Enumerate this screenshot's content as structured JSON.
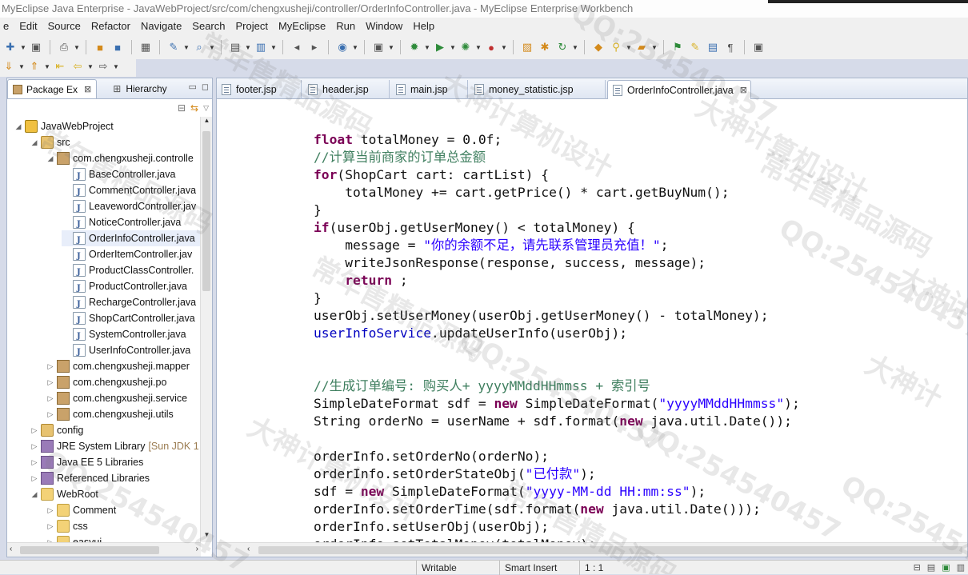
{
  "window": {
    "title": "MyEclipse Java Enterprise - JavaWebProject/src/com/chengxusheji/controller/OrderInfoController.java - MyEclipse Enterprise Workbench"
  },
  "menu": [
    {
      "label": "File",
      "mnemonic": "F",
      "rest": "ile"
    },
    {
      "label": "Edit",
      "mnemonic": "E",
      "rest": "dit"
    },
    {
      "label": "Source",
      "mnemonic": "S",
      "rest": "ource"
    },
    {
      "label": "Refactor",
      "mnemonic": "T",
      "rest": "Refactor"
    },
    {
      "label": "Navigate",
      "mnemonic": "N",
      "rest": "avigate"
    },
    {
      "label": "Search",
      "mnemonic": "a",
      "rest": "Search"
    },
    {
      "label": "Project",
      "mnemonic": "P",
      "rest": "roject"
    },
    {
      "label": "MyEclipse",
      "mnemonic": "y",
      "rest": "MyEclipse"
    },
    {
      "label": "Run",
      "mnemonic": "R",
      "rest": "un"
    },
    {
      "label": "Window",
      "mnemonic": "W",
      "rest": "indow"
    },
    {
      "label": "Help",
      "mnemonic": "H",
      "rest": "elp"
    }
  ],
  "menu_display": [
    "e",
    "Edit",
    "Source",
    "Refactor",
    "Navigate",
    "Search",
    "Project",
    "MyEclipse",
    "Run",
    "Window",
    "Help"
  ],
  "toolbar_icons": [
    "new-icon",
    "save-icon",
    "print-icon",
    "build-icon",
    "debug-icon",
    "run-icon",
    "deploy-icon",
    "server-icon",
    "open-type-icon",
    "search-icon",
    "perspective-java-icon",
    "perspective-debug-icon"
  ],
  "left_panel": {
    "tabs": [
      {
        "label": "Package Ex",
        "close": "⊠"
      },
      {
        "label": "Hierarchy"
      }
    ],
    "tree": [
      {
        "label": "JavaWebProject",
        "level": 0,
        "type": "project",
        "expanded": true
      },
      {
        "label": "src",
        "level": 1,
        "type": "srcfolder",
        "expanded": true
      },
      {
        "label": "com.chengxusheji.controlle",
        "level": 2,
        "type": "pkg",
        "expanded": true
      },
      {
        "label": "BaseController.java",
        "level": 3,
        "type": "java"
      },
      {
        "label": "CommentController.java",
        "level": 3,
        "type": "java"
      },
      {
        "label": "LeavewordController.jav",
        "level": 3,
        "type": "java"
      },
      {
        "label": "NoticeController.java",
        "level": 3,
        "type": "java"
      },
      {
        "label": "OrderInfoController.java",
        "level": 3,
        "type": "java",
        "selected": true
      },
      {
        "label": "OrderItemController.jav",
        "level": 3,
        "type": "java"
      },
      {
        "label": "ProductClassController.",
        "level": 3,
        "type": "java"
      },
      {
        "label": "ProductController.java",
        "level": 3,
        "type": "java"
      },
      {
        "label": "RechargeController.java",
        "level": 3,
        "type": "java"
      },
      {
        "label": "ShopCartController.java",
        "level": 3,
        "type": "java"
      },
      {
        "label": "SystemController.java",
        "level": 3,
        "type": "java"
      },
      {
        "label": "UserInfoController.java",
        "level": 3,
        "type": "java"
      },
      {
        "label": "com.chengxusheji.mapper",
        "level": 2,
        "type": "pkg"
      },
      {
        "label": "com.chengxusheji.po",
        "level": 2,
        "type": "pkg"
      },
      {
        "label": "com.chengxusheji.service",
        "level": 2,
        "type": "pkg"
      },
      {
        "label": "com.chengxusheji.utils",
        "level": 2,
        "type": "pkg"
      },
      {
        "label": "config",
        "level": 1,
        "type": "srcfolder"
      },
      {
        "label": "JRE System Library",
        "decoration": "[Sun JDK 1",
        "level": 1,
        "type": "lib"
      },
      {
        "label": "Java EE 5 Libraries",
        "level": 1,
        "type": "lib"
      },
      {
        "label": "Referenced Libraries",
        "level": 1,
        "type": "lib"
      },
      {
        "label": "WebRoot",
        "level": 1,
        "type": "folder",
        "expanded": true
      },
      {
        "label": "Comment",
        "level": 2,
        "type": "folder"
      },
      {
        "label": "css",
        "level": 2,
        "type": "folder"
      },
      {
        "label": "easyui",
        "level": 2,
        "type": "folder"
      }
    ]
  },
  "editor": {
    "tabs": [
      {
        "label": "footer.jsp"
      },
      {
        "label": "header.jsp"
      },
      {
        "label": "main.jsp"
      },
      {
        "label": "money_statistic.jsp"
      },
      {
        "label": "OrderInfoController.java",
        "active": true,
        "close": "⊠"
      }
    ],
    "code_lines": [
      [
        {
          "t": "kw",
          "v": "float"
        },
        {
          "t": "",
          "v": " totalMoney = 0.0f;"
        }
      ],
      [
        {
          "t": "cm",
          "v": "//计算当前商家的订单总金额"
        }
      ],
      [
        {
          "t": "kw",
          "v": "for"
        },
        {
          "t": "",
          "v": "(ShopCart cart: cartList) {"
        }
      ],
      [
        {
          "t": "",
          "v": "    totalMoney += cart.getPrice() * cart.getBuyNum();"
        }
      ],
      [
        {
          "t": "",
          "v": "}"
        }
      ],
      [
        {
          "t": "kw",
          "v": "if"
        },
        {
          "t": "",
          "v": "(userObj.getUserMoney() < totalMoney) {"
        }
      ],
      [
        {
          "t": "",
          "v": "    message = "
        },
        {
          "t": "st",
          "v": "\"你的余额不足，请先联系管理员充值！\""
        },
        {
          "t": "",
          "v": ";"
        }
      ],
      [
        {
          "t": "",
          "v": "    writeJsonResponse(response, success, message);"
        }
      ],
      [
        {
          "t": "",
          "v": "    "
        },
        {
          "t": "kw",
          "v": "return"
        },
        {
          "t": "",
          "v": " ;"
        }
      ],
      [
        {
          "t": "",
          "v": "}"
        }
      ],
      [
        {
          "t": "",
          "v": "userObj.setUserMoney(userObj.getUserMoney() - totalMoney);"
        }
      ],
      [
        {
          "t": "fd",
          "v": "userInfoService"
        },
        {
          "t": "",
          "v": ".updateUserInfo(userObj);"
        }
      ],
      [],
      [],
      [
        {
          "t": "cm",
          "v": "//生成订单编号: 购买人+ yyyyMMddHHmmss + 索引号"
        }
      ],
      [
        {
          "t": "",
          "v": "SimpleDateFormat sdf = "
        },
        {
          "t": "kw",
          "v": "new"
        },
        {
          "t": "",
          "v": " SimpleDateFormat("
        },
        {
          "t": "st",
          "v": "\"yyyyMMddHHmmss\""
        },
        {
          "t": "",
          "v": ");"
        }
      ],
      [
        {
          "t": "",
          "v": "String orderNo = userName + sdf.format("
        },
        {
          "t": "kw",
          "v": "new"
        },
        {
          "t": "",
          "v": " java.util.Date());"
        }
      ],
      [],
      [
        {
          "t": "",
          "v": "orderInfo.setOrderNo(orderNo);"
        }
      ],
      [
        {
          "t": "",
          "v": "orderInfo.setOrderStateObj("
        },
        {
          "t": "st",
          "v": "\"已付款\""
        },
        {
          "t": "",
          "v": ");"
        }
      ],
      [
        {
          "t": "",
          "v": "sdf = "
        },
        {
          "t": "kw",
          "v": "new"
        },
        {
          "t": "",
          "v": " SimpleDateFormat("
        },
        {
          "t": "st",
          "v": "\"yyyy-MM-dd HH:mm:ss\""
        },
        {
          "t": "",
          "v": ");"
        }
      ],
      [
        {
          "t": "",
          "v": "orderInfo.setOrderTime(sdf.format("
        },
        {
          "t": "kw",
          "v": "new"
        },
        {
          "t": "",
          "v": " java.util.Date()));"
        }
      ],
      [
        {
          "t": "",
          "v": "orderInfo.setUserObj(userObj);"
        }
      ],
      [
        {
          "t": "",
          "v": "orderInfo.setTotalMoney(totalMoney);"
        }
      ]
    ]
  },
  "status": {
    "writable": "Writable",
    "insert_mode": "Smart Insert",
    "position": "1 : 1"
  },
  "watermarks": [
    "QQ:254540457",
    "常年售精品源码",
    "大神计算机设计",
    "QQ:254540457",
    "常年售精品源码",
    "大神计算机设计",
    "QQ:254540457",
    "常年售精品源码",
    "大神计",
    "QQ:254540457",
    "大神计算机设计",
    "常年售精品源码",
    "QQ:2545404",
    "QQ:254540457",
    "常年售精品源码",
    "大神计"
  ]
}
